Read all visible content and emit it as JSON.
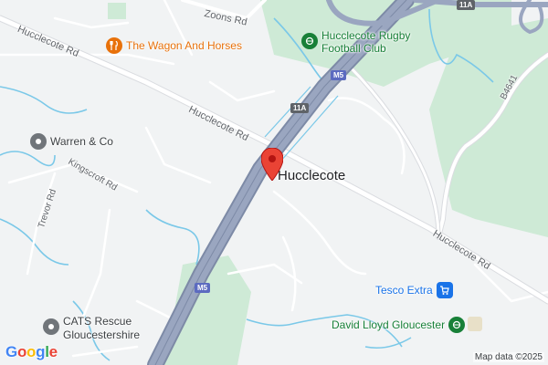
{
  "map": {
    "place_label": "Hucclecote",
    "roads": {
      "hucclecote_rd_1": "Hucclecote Rd",
      "hucclecote_rd_2": "Hucclecote Rd",
      "hucclecote_rd_3": "Hucclecote Rd",
      "zoons_rd": "Zoons Rd",
      "kingscroft_rd": "Kingscroft Rd",
      "trevor_rd": "Trevor Rd",
      "b4641": "B4641"
    },
    "shields": {
      "m5_top": "M5",
      "m5_bottom": "M5",
      "jct_11a_1": "11A",
      "jct_11a_2": "11A"
    },
    "pois": [
      {
        "name": "The Wagon And Horses",
        "icon": "fork-knife-icon",
        "color": "#e8710a"
      },
      {
        "name": "Hucclecote Rugby Football Club",
        "line1": "Hucclecote Rugby",
        "line2": "Football Club",
        "icon": "sports-icon",
        "color": "#188038"
      },
      {
        "name": "Warren & Co",
        "icon": "place-icon",
        "color": "#70757a"
      },
      {
        "name": "Tesco Extra",
        "icon": "shopping-cart-icon",
        "color": "#1a73e8"
      },
      {
        "name": "David Lloyd Gloucester",
        "icon": "sports-icon",
        "color": "#188038"
      },
      {
        "name": "CATS Rescue Gloucestershire",
        "line1": "CATS Rescue",
        "line2": "Gloucestershire",
        "icon": "place-icon",
        "color": "#70757a"
      }
    ],
    "marker": {
      "icon": "map-pin-icon",
      "color": "#ea4335"
    },
    "attribution": "Map data ©2025",
    "logo": "Google",
    "colors": {
      "background": "#f1f3f4",
      "green": "#ceead6",
      "water": "#7ac8e8",
      "motorway": "#8e9bb5",
      "road": "#ffffff"
    }
  }
}
